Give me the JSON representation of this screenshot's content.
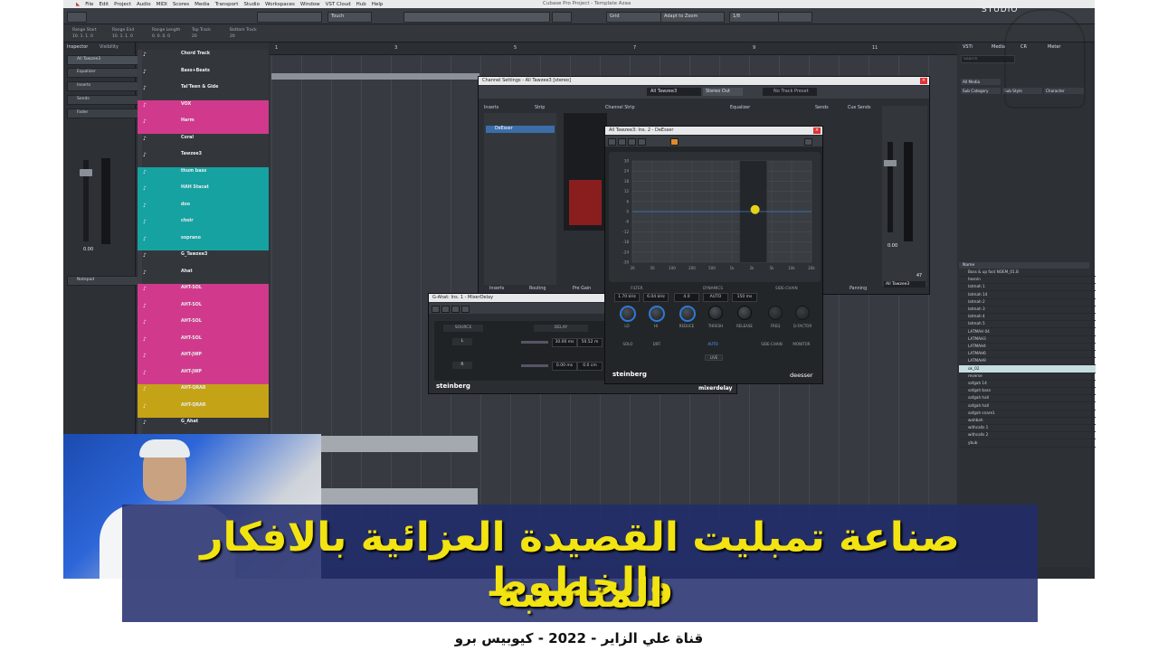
{
  "window": {
    "title": "Cubase Pro Project - Template Azaa",
    "menu": [
      "File",
      "Edit",
      "Project",
      "Audio",
      "MIDI",
      "Scores",
      "Media",
      "Transport",
      "Studio",
      "Workspaces",
      "Window",
      "VST Cloud",
      "Hub",
      "Help"
    ]
  },
  "toolbar": {
    "automation_mode": "Touch",
    "snap_type": "Grid",
    "snap_mode": "Adapt to Zoom",
    "quantize": "1/8"
  },
  "infoline": {
    "cells": [
      {
        "label": "Range Start",
        "value": "10. 1. 1. 0"
      },
      {
        "label": "Range End",
        "value": "10. 1. 1. 0"
      },
      {
        "label": "Range Length",
        "value": "0. 0. 0. 0"
      },
      {
        "label": "Top Track",
        "value": "20"
      },
      {
        "label": "Bottom Track",
        "value": "20"
      }
    ]
  },
  "inspector": {
    "tabs": [
      "Inspector",
      "Visibility"
    ],
    "track_name": "All Tawzee3",
    "sections": [
      "Equalizer",
      "Inserts",
      "Sends",
      "Fader",
      "Notepad"
    ],
    "fader_value": "0.00"
  },
  "tracks": [
    {
      "name": "Chord Track",
      "color": "#3a3e44"
    },
    {
      "name": "Bass+Beats",
      "color": "#3a3e44"
    },
    {
      "name": "Tal'Teen & Gide",
      "color": "#3a3e44"
    },
    {
      "name": "VOX",
      "color": "#d13a8c"
    },
    {
      "name": "Harm",
      "color": "#d13a8c"
    },
    {
      "name": "Coral",
      "color": "#3a3e44"
    },
    {
      "name": "Tawzee3",
      "color": "#3a3e44"
    },
    {
      "name": "thum bass",
      "color": "#17a2a2"
    },
    {
      "name": "HAH Stacat",
      "color": "#17a2a2"
    },
    {
      "name": "doo",
      "color": "#17a2a2"
    },
    {
      "name": "choir",
      "color": "#17a2a2"
    },
    {
      "name": "soprano",
      "color": "#17a2a2"
    },
    {
      "name": "G_Tawzee3",
      "color": "#3a3e44"
    },
    {
      "name": "Ahat",
      "color": "#3a3e44"
    },
    {
      "name": "AHT-SOL",
      "color": "#d13a8c"
    },
    {
      "name": "AHT-SOL",
      "color": "#d13a8c"
    },
    {
      "name": "AHT-SOL",
      "color": "#d13a8c"
    },
    {
      "name": "AHT-SOL",
      "color": "#d13a8c"
    },
    {
      "name": "AHT-JWP",
      "color": "#d13a8c"
    },
    {
      "name": "AHT-JWP",
      "color": "#d13a8c"
    },
    {
      "name": "AHT-QRAR",
      "color": "#c5a317"
    },
    {
      "name": "AHT-QRAR",
      "color": "#c5a317"
    },
    {
      "name": "G_Ahat",
      "color": "#3a3e44"
    }
  ],
  "ruler": {
    "marks": [
      "1",
      "3",
      "5",
      "7",
      "9",
      "11"
    ]
  },
  "channel_settings": {
    "title": "Channel Settings - All Tawzee3 [stereo]",
    "channel_name": "All Tawzee3",
    "output": "Stereo Out",
    "preset": "No Track Preset",
    "sections": [
      "Inserts",
      "Strip",
      "Channel Strip",
      "Equalizer",
      "Sends",
      "Cue Sends"
    ],
    "insert_slot": "DeEsser",
    "bottom_tabs": [
      "Inserts",
      "Routing",
      "Pre Gain",
      "Panning"
    ],
    "fader_value": "0.00",
    "pan_value": "47",
    "channel_label": "All Tawzee3"
  },
  "deesser": {
    "title": "All Tawzee3: Ins. 2 - DeEsser",
    "yaxis": [
      "30",
      "24",
      "18",
      "12",
      "6",
      "0",
      "-6",
      "-12",
      "-18",
      "-24",
      "-30"
    ],
    "xaxis": [
      "20",
      "50",
      "100",
      "200",
      "500",
      "1k",
      "2k",
      "5k",
      "10k",
      "20k"
    ],
    "sections": [
      "FILTER",
      "DYNAMICS",
      "SIDE-CHAIN"
    ],
    "values": {
      "lo": "1.70 kHz",
      "hi": "6.04 kHz",
      "reduction": "4.0",
      "thresh": "AUTO",
      "release": "150 ms"
    },
    "knobs": [
      "LO",
      "HI",
      "REDUCE",
      "THRESH",
      "RELEASE",
      "FREQ",
      "Q-FACTOR"
    ],
    "toggles": [
      "SOLO",
      "DIFF",
      "AUTO",
      "SIDE-CHAIN",
      "MONITOR"
    ],
    "live_label": "LIVE",
    "brand": "steinberg",
    "product": "deesser"
  },
  "mixerdelay": {
    "title": "G-Ahat: Ins. 1 - MixerDelay",
    "headers": [
      "SOURCE",
      "DELAY"
    ],
    "rows": [
      {
        "src": "L",
        "ms": "30.00 ms",
        "cm": "50.52 m"
      },
      {
        "src": "R",
        "ms": "0.00 ms",
        "cm": "0.0 cm"
      }
    ],
    "brand": "steinberg",
    "product": "mixerdelay"
  },
  "right_zone": {
    "tabs": [
      "VSTi",
      "Media",
      "CR",
      "Meter"
    ],
    "search_placeholder": "Search",
    "filter1": "All Media",
    "columns": [
      "Sub Category",
      "Sub Style",
      "Character"
    ],
    "list_header": "Name",
    "items": [
      "Bass & up fast NOEM_01.B",
      "hosnin",
      "latmah 1",
      "latmah 14",
      "latmah 2",
      "latmah 3",
      "latmah 4",
      "latmah 5",
      "LATMAH 04",
      "LATMAH3",
      "LATMAH4",
      "LATMAH6",
      "LATMAH9",
      "ok_02",
      "reverse",
      "safgah 14",
      "safgah bass",
      "safgah hall",
      "safgah hall",
      "safgah snare1",
      "wahbah",
      "withcalls 1",
      "withcalls 2",
      "ybub"
    ],
    "selected_index": 13
  },
  "banner": {
    "line1": "صناعة تمبليت القصيدة العزائية بالافكار والخطوط",
    "line2": "المناسبة"
  },
  "caption": "قناة علي الزاير - 2022 -  كيوبيس برو",
  "studio_logo": "STUDIO"
}
